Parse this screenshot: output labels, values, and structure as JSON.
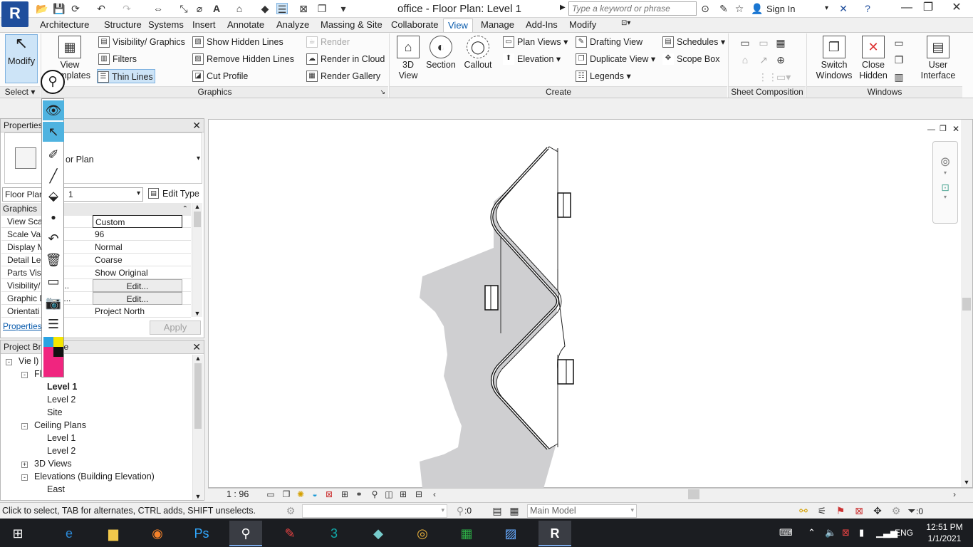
{
  "app": {
    "logo": "R",
    "title": "office - Floor Plan: Level 1",
    "search_placeholder": "Type a keyword or phrase",
    "sign_in": "Sign In"
  },
  "ribbon_tabs": [
    "Architecture",
    "Structure",
    "Systems",
    "Insert",
    "Annotate",
    "Analyze",
    "Massing & Site",
    "Collaborate",
    "View",
    "Manage",
    "Add-Ins",
    "Modify"
  ],
  "active_tab": "View",
  "ribbon": {
    "select_panel": {
      "modify": "Modify",
      "select": "Select"
    },
    "graphics_panel": {
      "label": "Graphics",
      "view_templates_1": "View",
      "view_templates_2": "Templates",
      "visibility_graphics": "Visibility/ Graphics",
      "filters": "Filters",
      "thin_lines": "Thin Lines",
      "show_hidden_lines": "Show  Hidden Lines",
      "remove_hidden_lines": "Remove  Hidden Lines",
      "cut_profile": "Cut  Profile",
      "render": "Render",
      "render_in_cloud": "Render  in Cloud",
      "render_gallery": "Render  Gallery"
    },
    "create_panel": {
      "label": "Create",
      "view_3d_1": "3D",
      "view_3d_2": "View",
      "section": "Section",
      "callout": "Callout",
      "plan_views": "Plan  Views",
      "elevation": "Elevation",
      "drafting_view": "Drafting  View",
      "duplicate_view": "Duplicate  View",
      "legends": "Legends",
      "schedules": "Schedules",
      "scope_box": "Scope  Box"
    },
    "sheet_panel": {
      "label": "Sheet Composition"
    },
    "windows_panel": {
      "label": "Windows",
      "switch_windows_1": "Switch",
      "switch_windows_2": "Windows",
      "close_hidden_1": "Close",
      "close_hidden_2": "Hidden",
      "user_interface_1": "User",
      "user_interface_2": "Interface"
    }
  },
  "properties": {
    "title": "Properties",
    "type_name": "or Plan",
    "instance_selector": "Floor Plan",
    "instance_value": "1",
    "edit_type": "Edit Type",
    "group": "Graphics",
    "rows": [
      {
        "key": "View Sca",
        "value": "Custom",
        "style": "box"
      },
      {
        "key": "Scale Val",
        "value": "96",
        "style": "plain"
      },
      {
        "key": "Display M",
        "value": "Normal",
        "style": "plain"
      },
      {
        "key": "Detail Le",
        "value": "Coarse",
        "style": "plain"
      },
      {
        "key": "Parts Visi",
        "value": "Show Original",
        "style": "plain"
      },
      {
        "key": "Visibility/   ics O...",
        "value": "Edit...",
        "style": "btn"
      },
      {
        "key": "Graphic D   Opti...",
        "value": "Edit...",
        "style": "btn"
      },
      {
        "key": "Orientati",
        "value": "Project North",
        "style": "plain"
      }
    ],
    "help_link": "Properties",
    "apply": "Apply"
  },
  "project_browser": {
    "title": "Project Bro    office",
    "items": [
      {
        "label": "Vie    l)",
        "indent": 0,
        "toggle": "-",
        "bold": false
      },
      {
        "label": "Fl     ans",
        "indent": 1,
        "toggle": "-",
        "bold": false
      },
      {
        "label": "Level 1",
        "indent": 2,
        "toggle": "",
        "bold": true
      },
      {
        "label": "Level 2",
        "indent": 2,
        "toggle": "",
        "bold": false
      },
      {
        "label": "Site",
        "indent": 2,
        "toggle": "",
        "bold": false
      },
      {
        "label": "Ceiling Plans",
        "indent": 1,
        "toggle": "-",
        "bold": false
      },
      {
        "label": "Level 1",
        "indent": 2,
        "toggle": "",
        "bold": false
      },
      {
        "label": "Level 2",
        "indent": 2,
        "toggle": "",
        "bold": false
      },
      {
        "label": "3D Views",
        "indent": 1,
        "toggle": "+",
        "bold": false
      },
      {
        "label": "Elevations (Building Elevation)",
        "indent": 1,
        "toggle": "-",
        "bold": false
      },
      {
        "label": "East",
        "indent": 2,
        "toggle": "",
        "bold": false
      }
    ]
  },
  "view_bar": {
    "scale": "1 : 96"
  },
  "status_bar": {
    "hint": "Click to select, TAB for alternates, CTRL adds, SHIFT unselects.",
    "worksets": ":0",
    "model": "Main Model",
    "filter_count": ":0"
  },
  "taskbar": {
    "lang": "ENG",
    "time": "12:51 PM",
    "date": "1/1/2021"
  },
  "colors": {
    "accent": "#0b5cad",
    "selected_bg": "#cde4f7",
    "shadow_gray": "#cfcfd1",
    "annot_pink": "#f0257f"
  }
}
